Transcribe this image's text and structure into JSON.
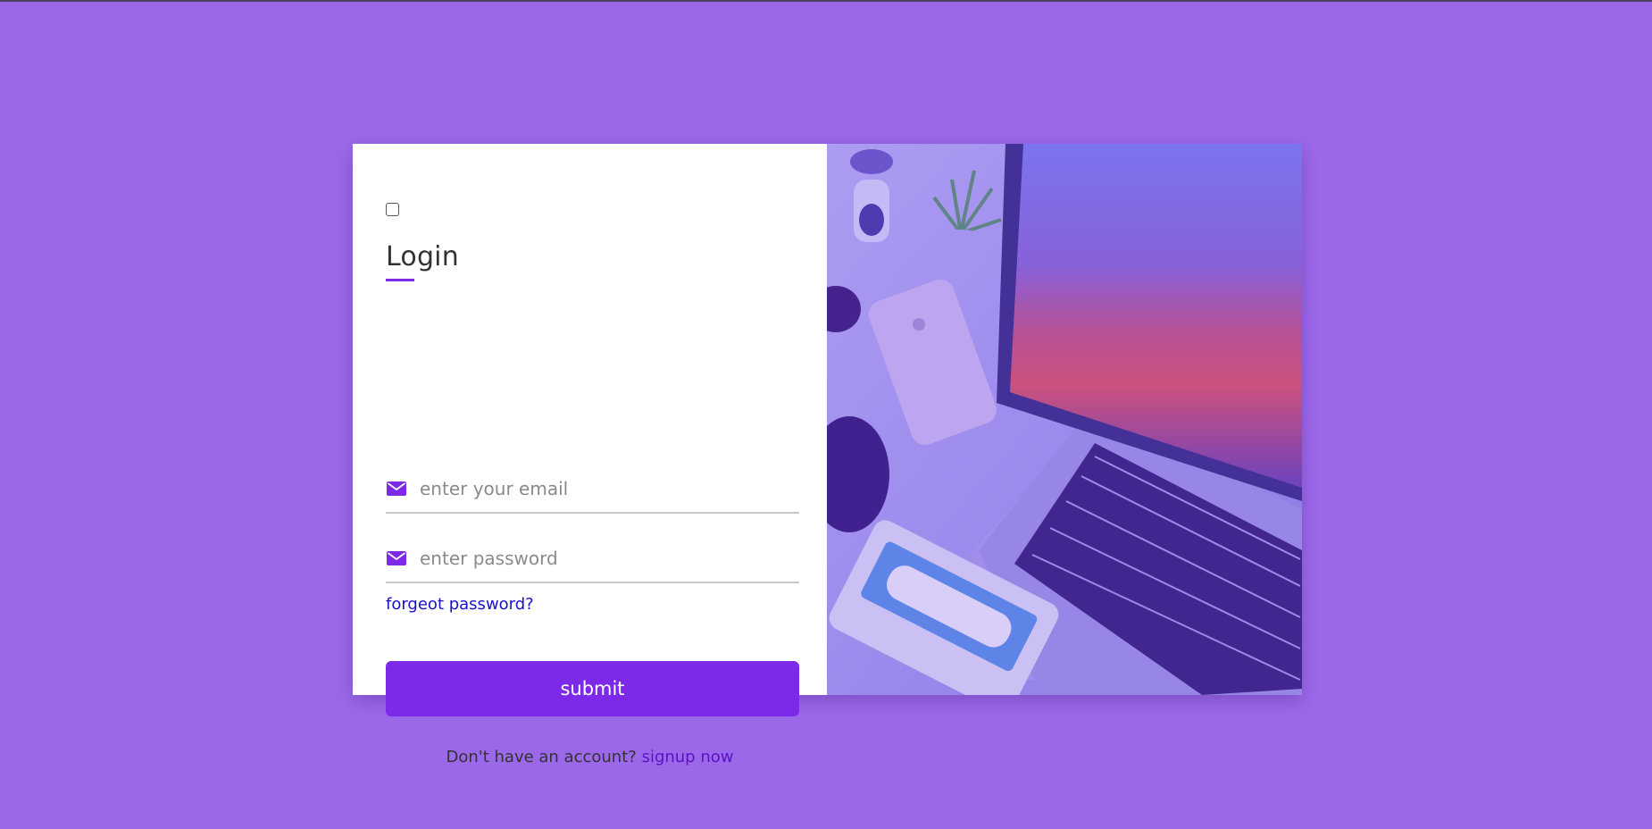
{
  "login": {
    "title": "Login",
    "remember_checked": false,
    "email_placeholder": "enter your email",
    "password_placeholder": "enter password",
    "forgot_label": "forgeot password?",
    "submit_label": "submit",
    "signup_prompt": "Don't have an account?",
    "signup_label": "signup now"
  },
  "icons": {
    "email_field": "envelope-icon",
    "password_field": "envelope-icon"
  },
  "colors": {
    "page_background": "#9b68ea",
    "accent": "#7d2ae8",
    "link": "#1a10c8",
    "signup_link": "#5b12c4"
  }
}
